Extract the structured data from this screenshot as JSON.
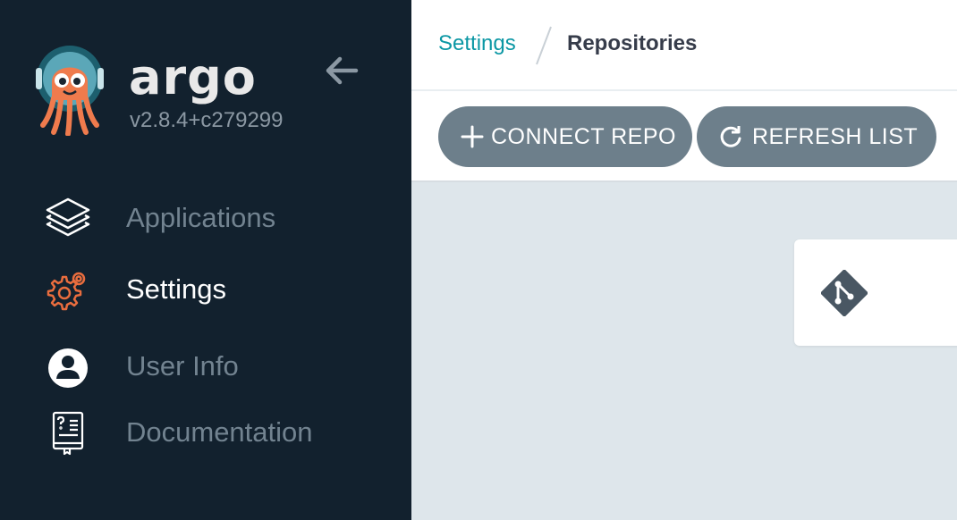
{
  "brand": {
    "name": "argo",
    "version": "v2.8.4+c279299",
    "logo_icon": "argo-octopus-logo"
  },
  "sidebar": {
    "collapse_icon": "arrow-left-icon",
    "items": [
      {
        "label": "Applications",
        "icon": "layers-icon",
        "active": false
      },
      {
        "label": "Settings",
        "icon": "gear-icon",
        "active": true
      },
      {
        "label": "User Info",
        "icon": "user-circle-icon",
        "active": false
      },
      {
        "label": "Documentation",
        "icon": "book-icon",
        "active": false
      }
    ]
  },
  "breadcrumb": {
    "parent": "Settings",
    "current": "Repositories"
  },
  "toolbar": {
    "connect_label": "CONNECT REPO",
    "refresh_label": "REFRESH LIST"
  },
  "repo_list": {
    "row_icon": "git-icon"
  },
  "colors": {
    "sidebar_bg": "#12212e",
    "accent": "#0b97a4",
    "settings_icon": "#e96d3e",
    "button_bg": "#6d7f8b",
    "content_bg": "#dee6eb"
  }
}
